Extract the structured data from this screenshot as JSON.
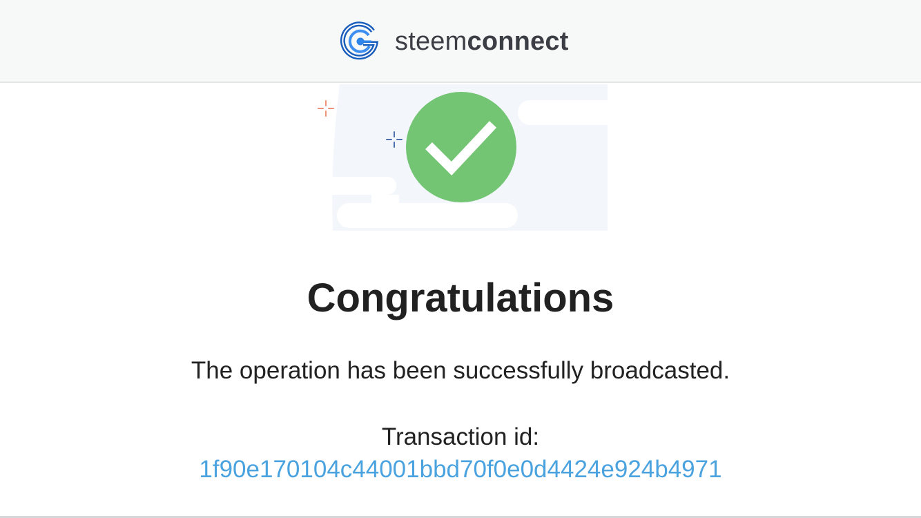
{
  "header": {
    "brand_light": "steem",
    "brand_bold": "connect",
    "logo_icon": "steemconnect-logo-icon"
  },
  "hero": {
    "icon": "success-checkmark-icon",
    "accent_color": "#73c574"
  },
  "result": {
    "title": "Congratulations",
    "message": "The operation has been successfully broadcasted.",
    "transaction_label": "Transaction id:",
    "transaction_id": "1f90e170104c44001bbd70f0e0d4424e924b4971"
  },
  "colors": {
    "link": "#4aa3df",
    "brand_blue": "#1a5ebd",
    "header_bg": "#f7f8f8"
  }
}
